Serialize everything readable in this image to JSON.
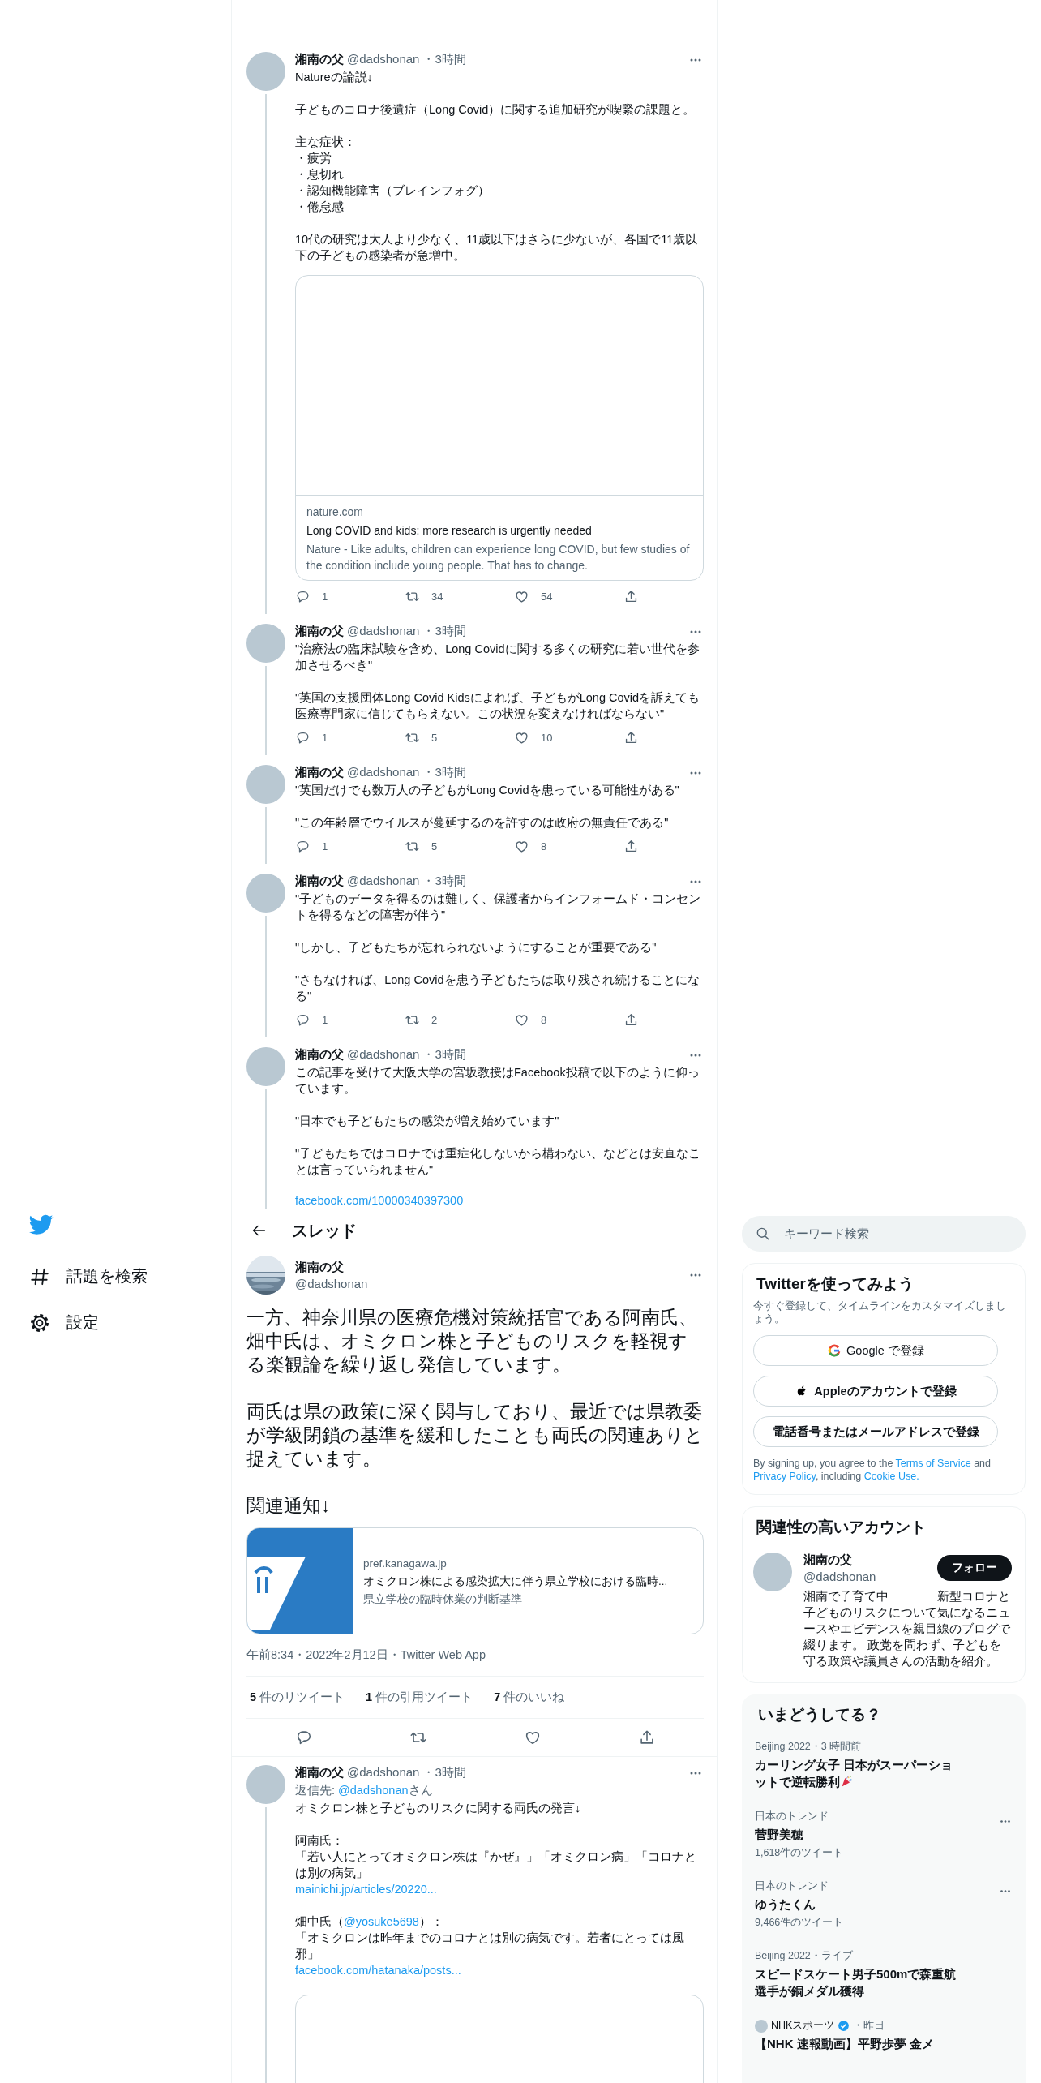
{
  "sidebar": {
    "items": [
      {
        "kind": "hashtag",
        "label": "話題を検索"
      },
      {
        "kind": "settings",
        "label": "設定"
      }
    ]
  },
  "thread_above": [
    {
      "name": "湘南の父",
      "handle": "@dadshonan",
      "time": "・3時間",
      "paragraphs": [
        [
          "Natureの論説↓"
        ],
        [
          "子どものコロナ後遺症（Long Covid）に関する追加研究が喫緊の課題と。"
        ],
        [
          "主な症状：",
          "・疲労",
          "・息切れ",
          "・認知機能障害（ブレインフォグ）",
          "・倦怠感"
        ],
        [
          "10代の研究は大人より少なく、11歳以下はさらに少ないが、各国で11歳以下の子どもの感染者が急増中。"
        ]
      ],
      "card": {
        "domain": "nature.com",
        "title": "Long COVID and kids: more research is urgently needed",
        "description": "Nature - Like adults, children can experience long COVID, but few studies of the condition include young people. That has to change."
      },
      "stats": {
        "replies": "1",
        "retweets": "34",
        "likes": "54"
      }
    },
    {
      "name": "湘南の父",
      "handle": "@dadshonan",
      "time": "・3時間",
      "paragraphs": [
        [
          "\"治療法の臨床試験を含め、Long Covidに関する多くの研究に若い世代を参加させるべき\""
        ],
        [
          "\"英国の支援団体Long Covid Kidsによれば、子どもがLong Covidを訴えても医療専門家に信じてもらえない。この状況を変えなければならない\""
        ]
      ],
      "stats": {
        "replies": "1",
        "retweets": "5",
        "likes": "10"
      }
    },
    {
      "name": "湘南の父",
      "handle": "@dadshonan",
      "time": "・3時間",
      "paragraphs": [
        [
          "\"英国だけでも数万人の子どもがLong Covidを患っている可能性がある\""
        ],
        [
          "\"この年齢層でウイルスが蔓延するのを許すのは政府の無責任である\""
        ]
      ],
      "stats": {
        "replies": "1",
        "retweets": "5",
        "likes": "8"
      }
    },
    {
      "name": "湘南の父",
      "handle": "@dadshonan",
      "time": "・3時間",
      "paragraphs": [
        [
          "\"子どものデータを得るのは難しく、保護者からインフォームド・コンセントを得るなどの障害が伴う\""
        ],
        [
          "\"しかし、子どもたちが忘れられないようにすることが重要である\""
        ],
        [
          "\"さもなければ、Long Covidを患う子どもたちは取り残され続けることになる\""
        ]
      ],
      "stats": {
        "replies": "1",
        "retweets": "2",
        "likes": "8"
      }
    },
    {
      "name": "湘南の父",
      "handle": "@dadshonan",
      "time": "・3時間",
      "paragraphs": [
        [
          "この記事を受けて大阪大学の宮坂教授はFacebook投稿で以下のように仰っています。"
        ],
        [
          "\"日本でも子どもたちの感染が増え始めています\""
        ],
        [
          "\"子どもたちではコロナでは重症化しないから構わない、などとは安直なことは言っていられません\""
        ]
      ],
      "link": "facebook.com/10000340397300"
    }
  ],
  "header": {
    "title": "スレッド"
  },
  "main_tweet": {
    "name": "湘南の父",
    "handle": "@dadshonan",
    "paragraphs": [
      "一方、神奈川県の医療危機対策統括官である阿南氏、畑中氏は、オミクロン株と子どものリスクを軽視する楽観論を繰り返し発信しています。",
      "両氏は県の政策に深く関与しており、最近では県教委が学級閉鎖の基準を緩和したことも両氏の関連ありと捉えています。",
      "関連通知↓"
    ],
    "card": {
      "domain": "pref.kanagawa.jp",
      "title": "オミクロン株による感染拡大に伴う県立学校における臨時...",
      "description": "県立学校の臨時休業の判断基準"
    },
    "timestamp": "午前8:34・2022年2月12日・Twitter Web App",
    "stats": [
      {
        "count": "5",
        "label": "件のリツイート"
      },
      {
        "count": "1",
        "label": "件の引用ツイート"
      },
      {
        "count": "7",
        "label": "件のいいね"
      }
    ]
  },
  "reply": {
    "name": "湘南の父",
    "handle": "@dadshonan",
    "time": "・3時間",
    "reply_to": [
      {
        "text": "返信先: ",
        "link": false
      },
      {
        "text": "@dadshonan",
        "link": true
      },
      {
        "text": "さん",
        "link": false
      }
    ],
    "paragraphs": [
      [
        [
          {
            "text": "オミクロン株と子どものリスクに関する両氏の発言↓",
            "link": false
          }
        ]
      ],
      [
        [
          {
            "text": "阿南氏：",
            "link": false
          }
        ],
        [
          {
            "text": "「若い人にとってオミクロン株は『かぜ』」「オミクロン病」「コロナとは別の病気」",
            "link": false
          }
        ],
        [
          {
            "text": "mainichi.jp/articles/20220...",
            "link": true
          }
        ]
      ],
      [
        [
          {
            "text": "畑中氏（",
            "link": false
          },
          {
            "text": "@yosuke5698",
            "link": true
          },
          {
            "text": "）：",
            "link": false
          }
        ],
        [
          {
            "text": "「オミクロンは昨年までのコロナとは別の病気です。若者にとっては風邪」",
            "link": false
          }
        ],
        [
          {
            "text": "facebook.com/hatanaka/posts...",
            "link": true
          }
        ]
      ]
    ]
  },
  "search": {
    "placeholder": "キーワード検索"
  },
  "signup": {
    "title": "Twitterを使ってみよう",
    "subtitle": "今すぐ登録して、タイムラインをカスタマイズしましょう。",
    "buttons": [
      {
        "kind": "google",
        "label": "Google で登録"
      },
      {
        "kind": "apple",
        "label": "Appleのアカウントで登録"
      },
      {
        "kind": "phone",
        "label": "電話番号またはメールアドレスで登録"
      }
    ],
    "legal": [
      {
        "text": "By signing up, you agree to the ",
        "link": false
      },
      {
        "text": "Terms of Service",
        "link": true
      },
      {
        "text": " and ",
        "link": false
      },
      {
        "text": "Privacy Policy",
        "link": true
      },
      {
        "text": ", including ",
        "link": false
      },
      {
        "text": "Cookie Use.",
        "link": true
      }
    ]
  },
  "related": {
    "title": "関連性の高いアカウント",
    "account": {
      "name": "湘南の父",
      "handle": "@dadshonan",
      "follow_label": "フォロー",
      "bio": "湘南で子育て中　　　　新型コロナと子どものリスクについて気になるニュースやエビデンスを親目線のブログで綴ります。 政党を問わず、子どもを守る政策や議員さんの活動を紹介。"
    }
  },
  "trends": {
    "title": "いまどうしてる？",
    "items": [
      {
        "kind": "event",
        "context": "Beijing 2022・3 時間前",
        "title": "カーリング女子 日本がスーパーショットで逆転勝利",
        "celebration": true
      },
      {
        "kind": "trend",
        "context": "日本のトレンド",
        "title": "菅野美穂",
        "count": "1,618件のツイート"
      },
      {
        "kind": "trend",
        "context": "日本のトレンド",
        "title": "ゆうたくん",
        "count": "9,466件のツイート"
      },
      {
        "kind": "event",
        "context": "Beijing 2022・ライブ",
        "title": "スピードスケート男子500mで森重航選手が銅メダル獲得",
        "celebration": false
      },
      {
        "kind": "news",
        "source": "NHKスポーツ",
        "verified": true,
        "time": "・昨日",
        "title": "【NHK 速報動画】平野歩夢 金メ"
      }
    ]
  }
}
